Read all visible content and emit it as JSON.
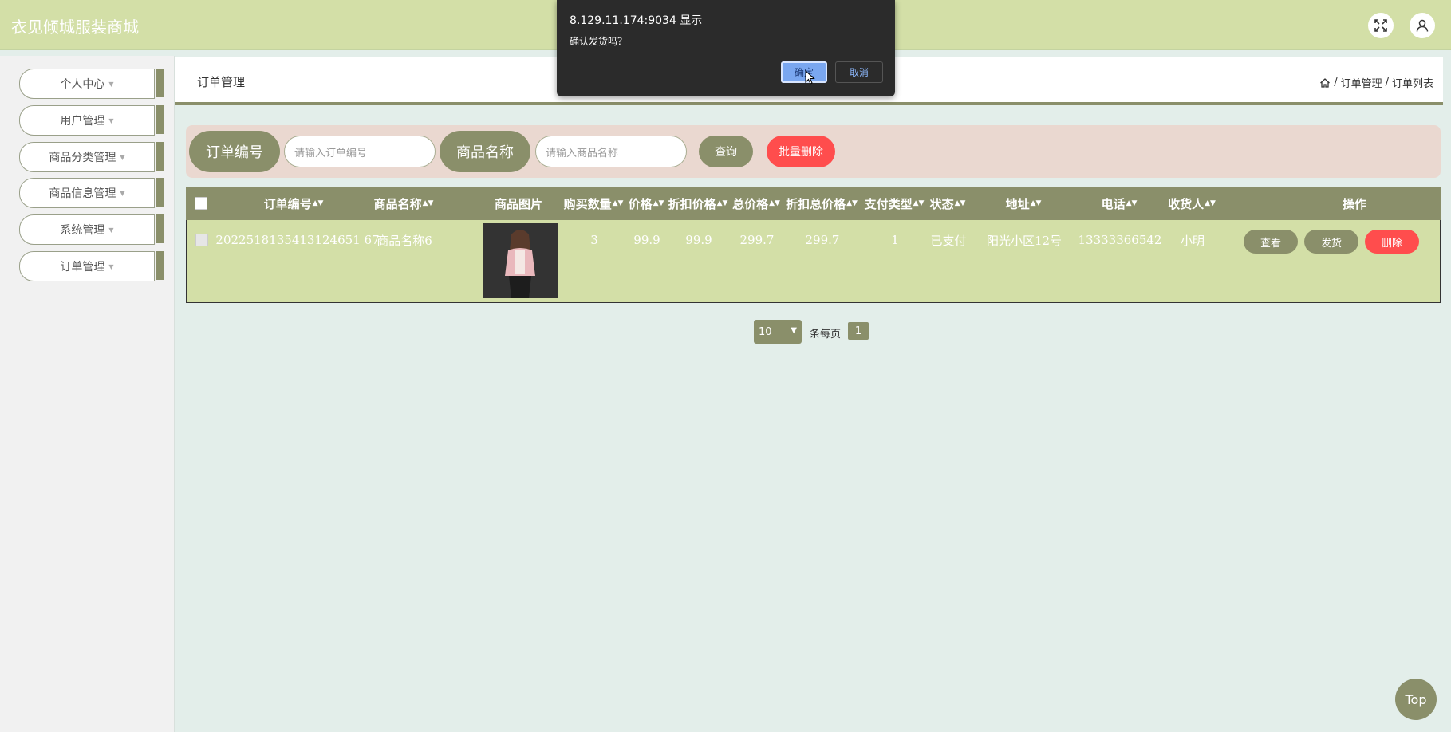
{
  "header": {
    "site_title": "衣见倾城服装商城"
  },
  "sidebar": {
    "items": [
      {
        "label": "个人中心"
      },
      {
        "label": "用户管理"
      },
      {
        "label": "商品分类管理"
      },
      {
        "label": "商品信息管理"
      },
      {
        "label": "系统管理"
      },
      {
        "label": "订单管理"
      }
    ]
  },
  "content": {
    "title": "订单管理",
    "breadcrumb": [
      "订单管理",
      "订单列表"
    ]
  },
  "search": {
    "order_no_label": "订单编号",
    "order_no_placeholder": "请输入订单编号",
    "product_name_label": "商品名称",
    "product_name_placeholder": "请输入商品名称",
    "query_label": "查询",
    "batch_delete_label": "批量删除"
  },
  "table": {
    "headers": [
      "订单编号",
      "商品名称",
      "商品图片",
      "购买数量",
      "价格",
      "折扣价格",
      "总价格",
      "折扣总价格",
      "支付类型",
      "状态",
      "地址",
      "电话",
      "收货人",
      "操作"
    ],
    "rows": [
      {
        "order_no": "2022518135413124651 67",
        "product_name": "商品名称6",
        "quantity": "3",
        "price": "99.9",
        "discount_price": "99.9",
        "total_price": "299.7",
        "discount_total_price": "299.7",
        "pay_type": "1",
        "status": "已支付",
        "address": "阳光小区12号",
        "phone": "13333366542",
        "receiver": "小明",
        "actions": {
          "view": "查看",
          "ship": "发货",
          "delete": "删除"
        }
      }
    ]
  },
  "pagination": {
    "page_size": "10",
    "per_page_label": "条每页",
    "current_page": "1"
  },
  "top_button": "Top",
  "dialog": {
    "title": "8.129.11.174:9034 显示",
    "message": "确认发货吗？",
    "ok_label": "确定",
    "cancel_label": "取消"
  }
}
